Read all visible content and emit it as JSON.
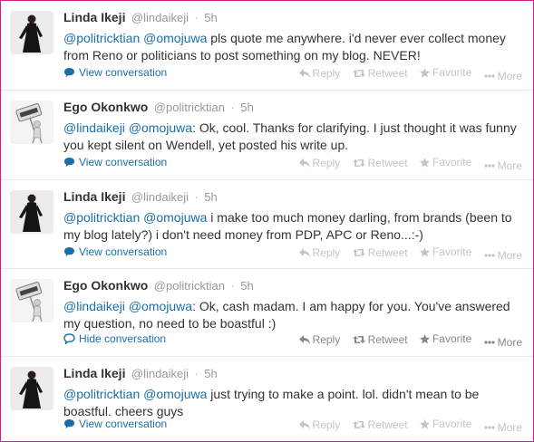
{
  "actions": {
    "reply": "Reply",
    "retweet": "Retweet",
    "favorite": "Favorite",
    "more": "More"
  },
  "tweets": [
    {
      "fullname": "Linda Ikeji",
      "username": "@lindaikeji",
      "time": "5h",
      "mention1": "@politricktian",
      "mention2": "@omojuwa",
      "body": " pls quote me anywhere. i'd never ever collect money from Reno or politicians to post something on my blog. NEVER!",
      "expand": "View conversation"
    },
    {
      "fullname": "Ego Okonkwo",
      "username": "@politricktian",
      "time": "5h",
      "mention1": "@lindaikeji",
      "mention2": "@omojuwa",
      "body": ": Ok, cool. Thanks for clarifying. I just thought it was funny you kept silent on Wendell, yet posted his write up.",
      "expand": "View conversation"
    },
    {
      "fullname": "Linda Ikeji",
      "username": "@lindaikeji",
      "time": "5h",
      "mention1": "@politricktian",
      "mention2": "@omojuwa",
      "body": " i make too much money darling, from brands (been to my blog lately?) i don't need money from PDP, APC or Reno...:-)",
      "expand": "View conversation"
    },
    {
      "fullname": "Ego Okonkwo",
      "username": "@politricktian",
      "time": "5h",
      "mention1": "@lindaikeji",
      "mention2": "@omojuwa",
      "body": ": Ok, cash madam. I am happy for you. You've answered my question, no need to be boastful :)",
      "expand": "Hide conversation"
    },
    {
      "fullname": "Linda Ikeji",
      "username": "@lindaikeji",
      "time": "5h",
      "mention1": "@politricktian",
      "mention2": "@omojuwa",
      "body": " just trying to make a point. lol. didn't mean to be boastful. cheers guys",
      "expand": "View conversation"
    }
  ],
  "avatars": {
    "linda": "woman-in-black-dress-photo",
    "ego": "freedom-sign-figure-icon"
  },
  "colors": {
    "border": "#d51c8c",
    "link": "#1a6fa8",
    "muted": "#999999",
    "action": "#c4c4c4"
  }
}
